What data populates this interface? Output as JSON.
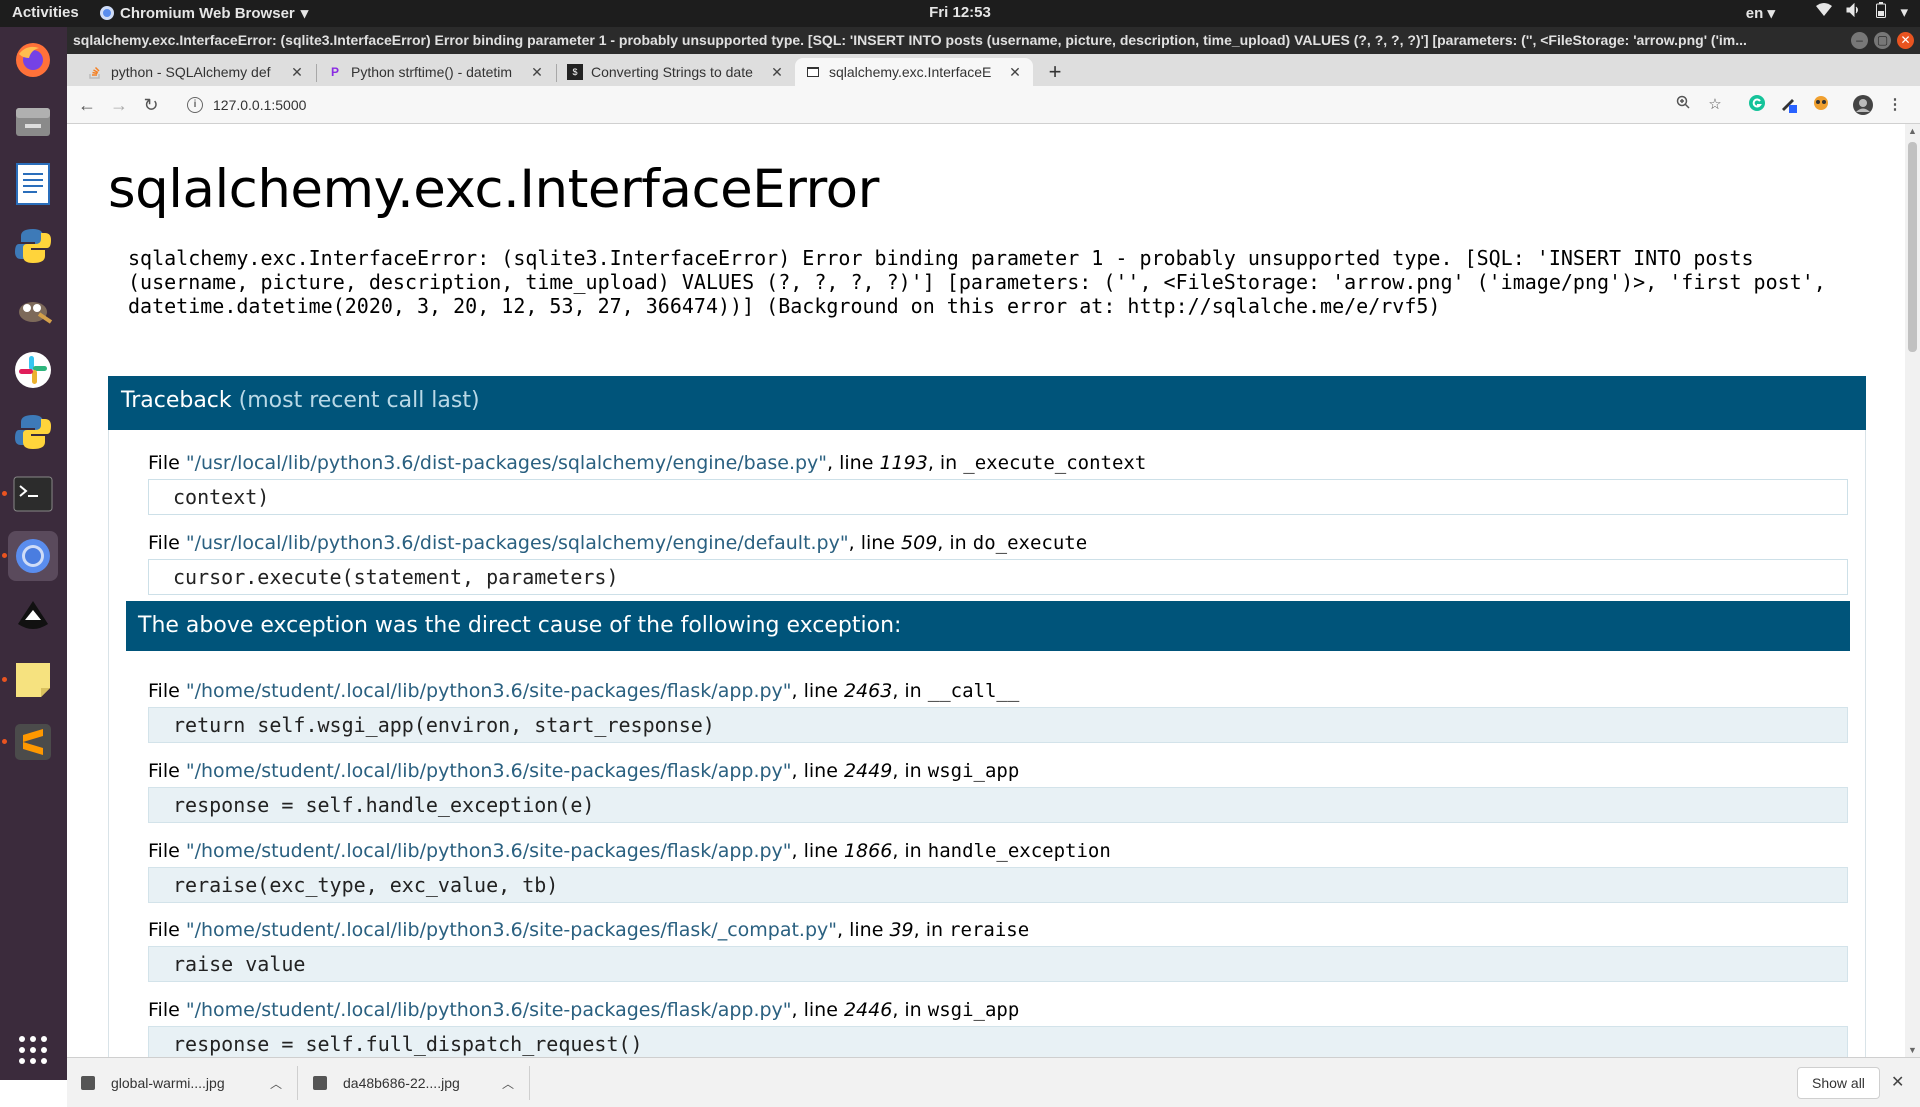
{
  "topbar": {
    "activities": "Activities",
    "app_name": "Chromium Web Browser",
    "clock": "Fri 12:53",
    "language": "en"
  },
  "window": {
    "title": "sqlalchemy.exc.InterfaceError: (sqlite3.InterfaceError) Error binding parameter 1 - probably unsupported type. [SQL: 'INSERT INTO posts (username, picture, description, time_upload) VALUES (?, ?, ?, ?)'] [parameters: ('', <FileStorage: 'arrow.png' ('im..."
  },
  "tabs": [
    {
      "label": "python - SQLAlchemy def",
      "favicon": "stackoverflow-icon"
    },
    {
      "label": "Python strftime() - datetim",
      "favicon": "programiz-icon"
    },
    {
      "label": "Converting Strings to date",
      "favicon": "terminal-site-icon"
    },
    {
      "label": "sqlalchemy.exc.InterfaceE",
      "favicon": "page-icon",
      "active": true
    }
  ],
  "address_bar": {
    "url": "127.0.0.1:5000"
  },
  "page": {
    "title": "sqlalchemy.exc.InterfaceError",
    "message": "sqlalchemy.exc.InterfaceError: (sqlite3.InterfaceError) Error binding parameter 1 - probably unsupported type. [SQL: 'INSERT INTO posts (username, picture, description, time_upload) VALUES (?, ?, ?, ?)'] [parameters: ('', <FileStorage: 'arrow.png' ('image/png')>, 'first post', datetime.datetime(2020, 3, 20, 12, 53, 27, 366474))] (Background on this error at: http://sqlalche.me/e/rvf5)",
    "traceback_title": "Traceback",
    "traceback_subtitle": "(most recent call last)",
    "frames_first": [
      {
        "file": "\"/usr/local/lib/python3.6/dist-packages/sqlalchemy/engine/base.py\"",
        "line": "1193",
        "func": "_execute_context",
        "code": "context)"
      },
      {
        "file": "\"/usr/local/lib/python3.6/dist-packages/sqlalchemy/engine/default.py\"",
        "line": "509",
        "func": "do_execute",
        "code": "cursor.execute(statement, parameters)"
      }
    ],
    "cause_text": "The above exception was the direct cause of the following exception:",
    "frames_second": [
      {
        "file": "\"/home/student/.local/lib/python3.6/site-packages/flask/app.py\"",
        "line": "2463",
        "func": "__call__",
        "code": "return self.wsgi_app(environ, start_response)"
      },
      {
        "file": "\"/home/student/.local/lib/python3.6/site-packages/flask/app.py\"",
        "line": "2449",
        "func": "wsgi_app",
        "code": "response = self.handle_exception(e)"
      },
      {
        "file": "\"/home/student/.local/lib/python3.6/site-packages/flask/app.py\"",
        "line": "1866",
        "func": "handle_exception",
        "code": "reraise(exc_type, exc_value, tb)"
      },
      {
        "file": "\"/home/student/.local/lib/python3.6/site-packages/flask/_compat.py\"",
        "line": "39",
        "func": "reraise",
        "code": "raise value"
      },
      {
        "file": "\"/home/student/.local/lib/python3.6/site-packages/flask/app.py\"",
        "line": "2446",
        "func": "wsgi_app",
        "code": "response = self.full_dispatch_request()"
      }
    ],
    "labels": {
      "file": "File ",
      "line": ", line ",
      "in": ", in "
    }
  },
  "downloads": {
    "items": [
      "global-warmi....jpg",
      "da48b686-22....jpg"
    ],
    "show_all": "Show all"
  },
  "dock": [
    "firefox-icon",
    "files-icon",
    "writer-icon",
    "python-icon",
    "gimp-icon",
    "slack-icon",
    "python-icon-2",
    "terminal-icon",
    "chromium-icon",
    "inkscape-icon",
    "notes-icon",
    "sublime-icon",
    "app-grid-icon"
  ],
  "colors": {
    "header_blue": "#00547a",
    "ubuntu_orange": "#e95420",
    "dock_bg": "#3b2b3c"
  }
}
